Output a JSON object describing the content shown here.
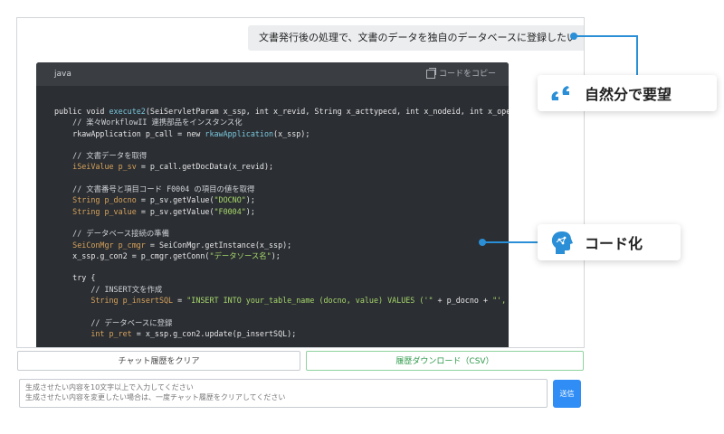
{
  "chat": {
    "user_message": "文書発行後の処理で、文書のデータを独自のデータベースに登録したい",
    "code_block": {
      "language": "java",
      "copy_label": "コードをコピー",
      "lines": [
        [
          {
            "t": "public void ",
            "c": "plain"
          },
          {
            "t": "execute2",
            "c": "fn"
          },
          {
            "t": "(SeiServletParam x_ssp, int x_revid, String x_acttypecd, int x_nodeid, int x_opercd",
            "c": "plain"
          }
        ],
        [
          {
            "t": "    // 楽々WorkflowII 連携部品をインスタンス化",
            "c": "comment"
          }
        ],
        [
          {
            "t": "    rkawApplication p_call = new ",
            "c": "plain"
          },
          {
            "t": "rkawApplication",
            "c": "fn"
          },
          {
            "t": "(x_ssp);",
            "c": "plain"
          }
        ],
        [],
        [
          {
            "t": "    // 文書データを取得",
            "c": "comment"
          }
        ],
        [
          {
            "t": "    iSeiValue p_sv ",
            "c": "type"
          },
          {
            "t": "= p_call.getDocData(x_revid);",
            "c": "plain"
          }
        ],
        [],
        [
          {
            "t": "    // 文書番号と項目コード F0004 の項目の値を取得",
            "c": "comment"
          }
        ],
        [
          {
            "t": "    String p_docno ",
            "c": "type"
          },
          {
            "t": "= p_sv.getValue(",
            "c": "plain"
          },
          {
            "t": "\"DOCNO\"",
            "c": "str"
          },
          {
            "t": ");",
            "c": "plain"
          }
        ],
        [
          {
            "t": "    String p_value ",
            "c": "type"
          },
          {
            "t": "= p_sv.getValue(",
            "c": "plain"
          },
          {
            "t": "\"F0004\"",
            "c": "str"
          },
          {
            "t": ");",
            "c": "plain"
          }
        ],
        [],
        [
          {
            "t": "    // データベース接続の準備",
            "c": "comment"
          }
        ],
        [
          {
            "t": "    SeiConMgr p_cmgr ",
            "c": "type"
          },
          {
            "t": "= SeiConMgr.getInstance(x_ssp);",
            "c": "plain"
          }
        ],
        [
          {
            "t": "    x_ssp.g_con2 = p_cmgr.getConn(",
            "c": "plain"
          },
          {
            "t": "\"データソース名\"",
            "c": "str"
          },
          {
            "t": ");",
            "c": "plain"
          }
        ],
        [],
        [
          {
            "t": "    try {",
            "c": "plain"
          }
        ],
        [
          {
            "t": "        // INSERT文を作成",
            "c": "comment"
          }
        ],
        [
          {
            "t": "        String p_insertSQL ",
            "c": "type"
          },
          {
            "t": "= ",
            "c": "plain"
          },
          {
            "t": "\"INSERT INTO your_table_name (docno, value) VALUES ('\"",
            "c": "str"
          },
          {
            "t": " + p_docno + ",
            "c": "plain"
          },
          {
            "t": "\"', '\"",
            "c": "str"
          },
          {
            "t": " +",
            "c": "plain"
          }
        ],
        [],
        [
          {
            "t": "        // データベースに登録",
            "c": "comment"
          }
        ],
        [
          {
            "t": "        int p_ret ",
            "c": "type"
          },
          {
            "t": "= x_ssp.g_con2.update(p_insertSQL);",
            "c": "plain"
          }
        ]
      ]
    }
  },
  "callouts": {
    "natural_language": {
      "label": "自然分で要望",
      "icon": "quote-icon"
    },
    "coding": {
      "label": "コード化",
      "icon": "ai-head-icon"
    }
  },
  "actions": {
    "clear_label": "チャット履歴をクリア",
    "csv_label": "履歴ダウンロード（CSV）",
    "send_label": "送信"
  },
  "input": {
    "placeholder_line1": "生成させたい内容を10文字以上で入力してください",
    "placeholder_line2": "生成させたい内容を変更したい場合は、一度チャット履歴をクリアしてください"
  },
  "colors": {
    "accent": "#2a8fd6",
    "send_button": "#2f8df5",
    "csv_button_text": "#2e9a4a",
    "code_bg": "#2b2e33"
  }
}
